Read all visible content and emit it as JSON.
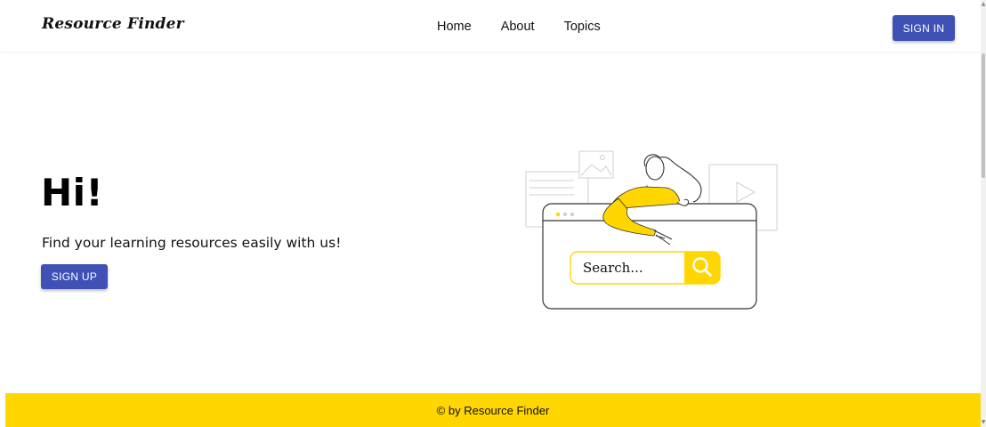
{
  "header": {
    "brand": "Resource Finder",
    "nav": [
      "Home",
      "About",
      "Topics"
    ],
    "signin_label": "SIGN IN"
  },
  "hero": {
    "title": "Hi!",
    "tagline": "Find your learning resources easily with us!",
    "signup_label": "SIGN UP"
  },
  "illustration": {
    "search_placeholder": "Search..."
  },
  "footer": {
    "text": "© by Resource Finder"
  },
  "colors": {
    "primary": "#3f51b5",
    "accent": "#ffd600"
  }
}
